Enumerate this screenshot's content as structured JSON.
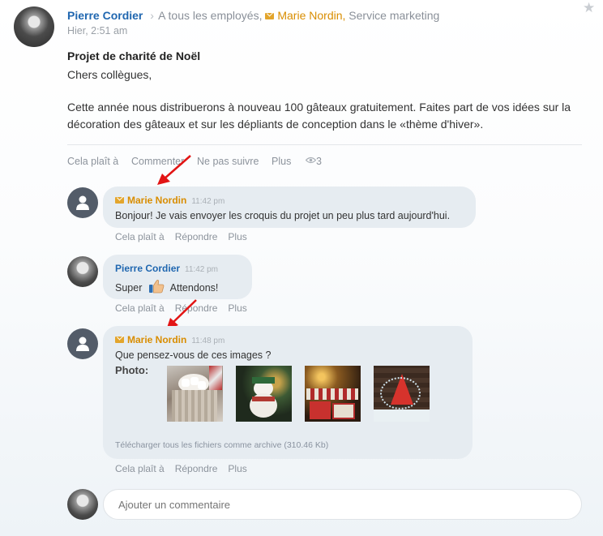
{
  "post": {
    "author": "Pierre Cordier",
    "recipients_prefix": "A tous les employés,",
    "recipient_name": "Marie Nordin,",
    "recipient_dept": "Service marketing",
    "timestamp": "Hier, 2:51 am",
    "title": "Projet de charité de Noël",
    "greeting": "Chers collègues,",
    "body": "Cette année nous distribuerons à nouveau 100 gâteaux gratuitement. Faites part de vos idées sur la décoration des gâteaux et sur les dépliants de conception dans le «thème d'hiver».",
    "actions": {
      "like": "Cela plaît à",
      "comment": "Commenter",
      "unfollow": "Ne pas suivre",
      "more": "Plus"
    },
    "view_count": "3"
  },
  "comments": [
    {
      "author": "Marie Nordin",
      "time": "11:42 pm",
      "text": "Bonjour! Je vais envoyer les croquis du projet un peu plus tard aujourd'hui."
    },
    {
      "author": "Pierre Cordier",
      "time": "11:42 pm",
      "text_before": "Super",
      "text_after": "Attendons!"
    },
    {
      "author": "Marie Nordin",
      "time": "11:48 pm",
      "text": "Que pensez-vous de ces images ?",
      "photo_label": "Photo:",
      "download_text": "Télécharger tous les fichiers comme archive (310.46 Kb)"
    }
  ],
  "comment_actions": {
    "like": "Cela plaît à",
    "reply": "Répondre",
    "more": "Plus"
  },
  "new_comment": {
    "placeholder": "Ajouter un commentaire"
  },
  "colors": {
    "link_blue": "#2067b0",
    "email_orange": "#d98d00",
    "bubble": "#e6ecf1",
    "arrow_red": "#e21414"
  },
  "icons": [
    "star-icon",
    "chevron-right-icon",
    "envelope-icon",
    "eye-icon",
    "thumbs-up-icon",
    "user-icon"
  ]
}
